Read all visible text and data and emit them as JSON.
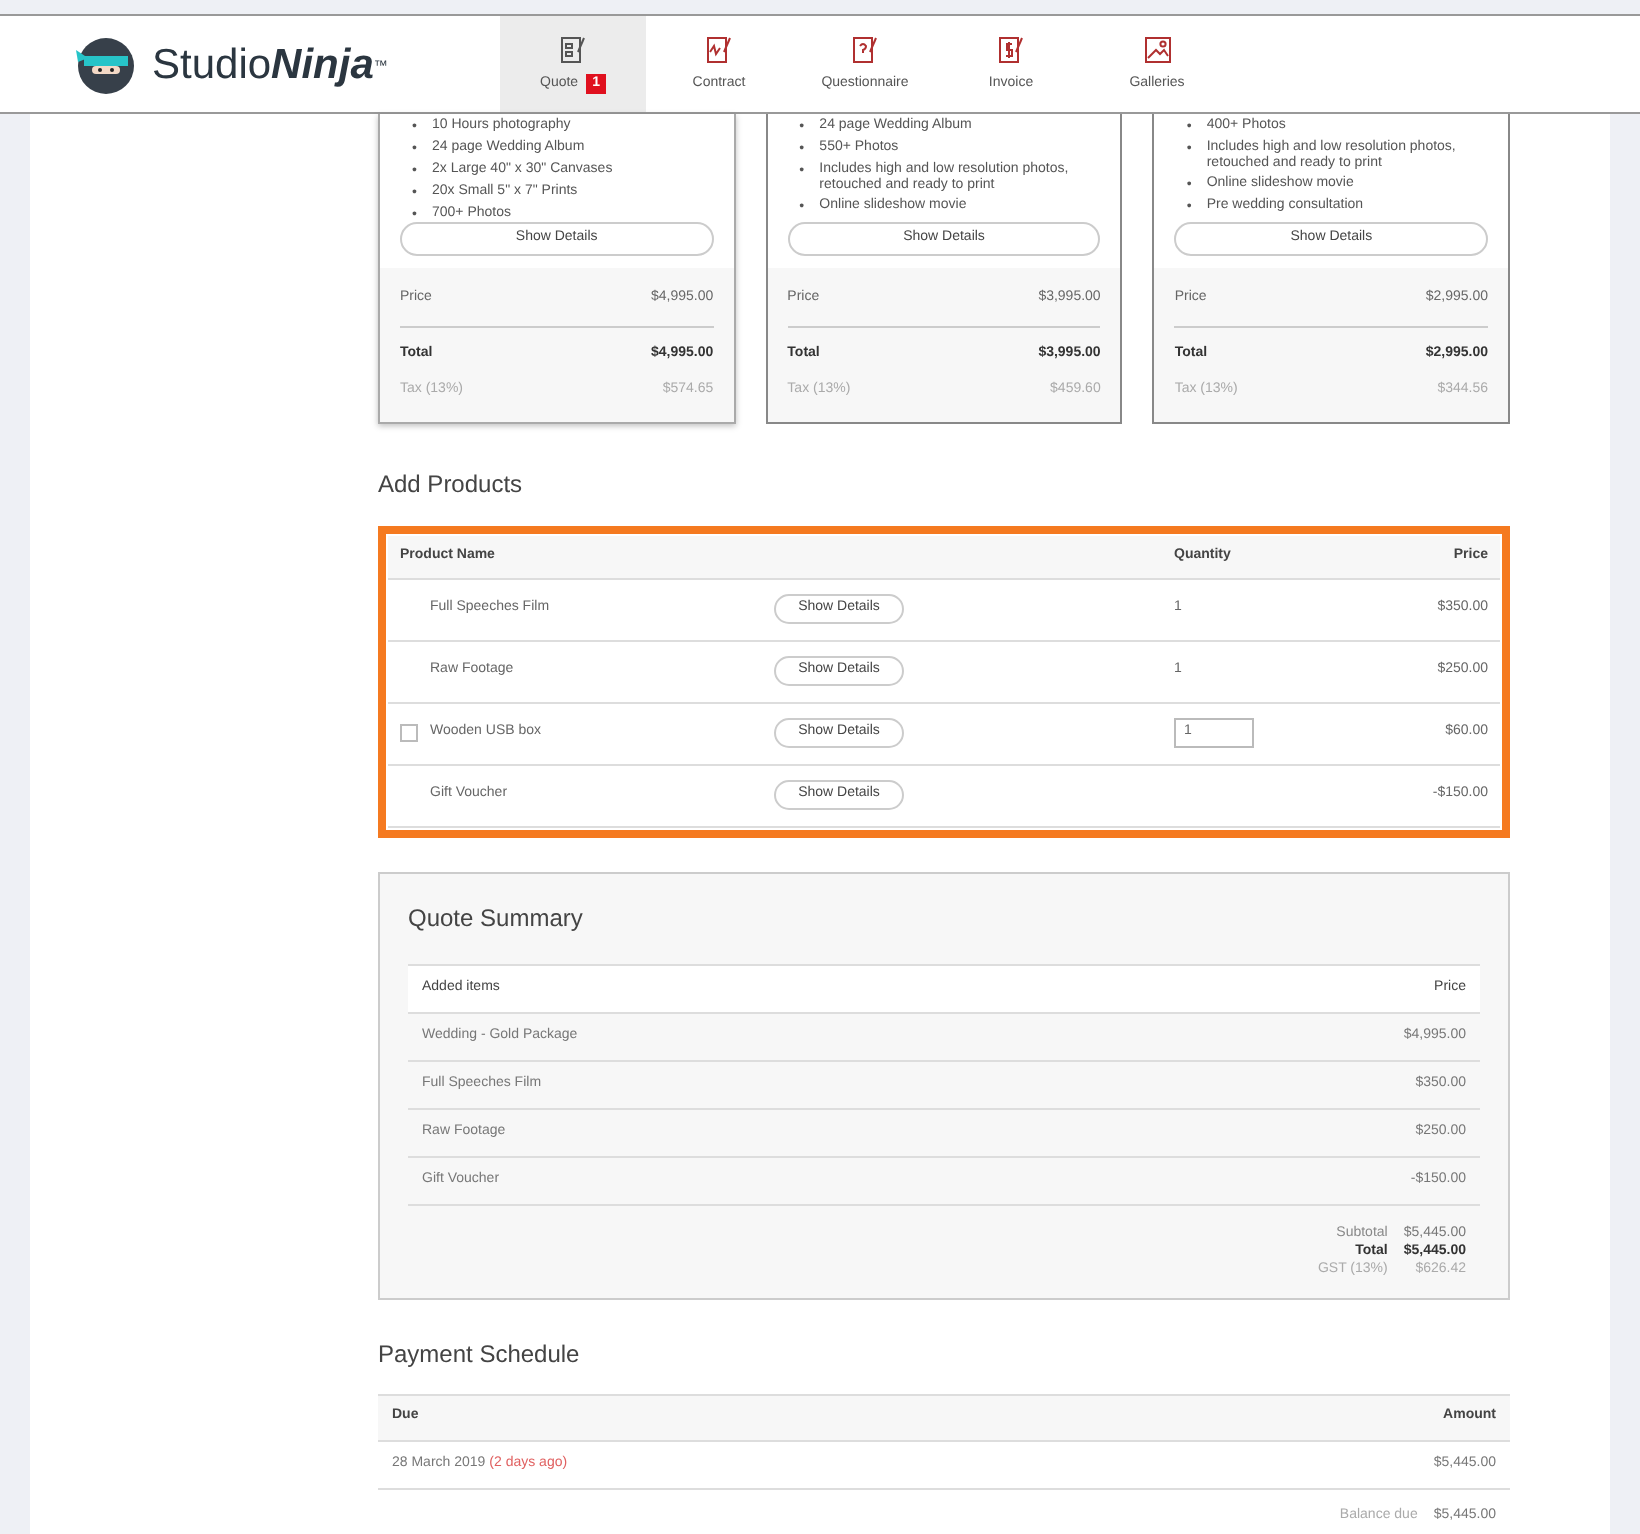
{
  "brand": {
    "name_light": "Studio",
    "name_bold": "Ninja",
    "mark": "™"
  },
  "nav": [
    {
      "label": "Quote",
      "selected": true,
      "badge": "1"
    },
    {
      "label": "Contract",
      "selected": false
    },
    {
      "label": "Questionnaire",
      "selected": false
    },
    {
      "label": "Invoice",
      "selected": false
    },
    {
      "label": "Galleries",
      "selected": false
    }
  ],
  "bullet": "•",
  "packages": [
    {
      "selected": true,
      "features": [
        "10 Hours photography",
        "24 page Wedding Album",
        "2x Large 40\" x 30\" Canvases",
        "20x Small 5\" x 7\" Prints",
        "700+ Photos"
      ],
      "button": "Show Details",
      "price_label": "Price",
      "price": "$4,995.00",
      "total_label": "Total",
      "total": "$4,995.00",
      "tax_label": "Tax (13%)",
      "tax": "$574.65"
    },
    {
      "selected": false,
      "features": [
        "24 page Wedding Album",
        "550+ Photos",
        "Includes high and low resolution photos, retouched and ready to print",
        "Online slideshow movie"
      ],
      "button": "Show Details",
      "price_label": "Price",
      "price": "$3,995.00",
      "total_label": "Total",
      "total": "$3,995.00",
      "tax_label": "Tax (13%)",
      "tax": "$459.60"
    },
    {
      "selected": false,
      "features": [
        "400+ Photos",
        "Includes high and low resolution photos, retouched and ready to print",
        "Online slideshow movie",
        "Pre wedding consultation"
      ],
      "button": "Show Details",
      "price_label": "Price",
      "price": "$2,995.00",
      "total_label": "Total",
      "total": "$2,995.00",
      "tax_label": "Tax (13%)",
      "tax": "$344.56"
    }
  ],
  "add_products": {
    "title": "Add Products",
    "columns": [
      "Product Name",
      "Quantity",
      "Price"
    ],
    "rows": [
      {
        "kind": "fixed",
        "name": "Full Speeches Film",
        "button": "Show Details",
        "quantity": "1",
        "price": "$350.00"
      },
      {
        "kind": "fixed",
        "name": "Raw Footage",
        "button": "Show Details",
        "quantity": "1",
        "price": "$250.00"
      },
      {
        "kind": "optional",
        "checked": false,
        "name": "Wooden USB box",
        "button": "Show Details",
        "quantity": "1",
        "price": "$60.00"
      },
      {
        "kind": "fixed",
        "name": "Gift Voucher",
        "button": "Show Details",
        "price": "-$150.00"
      }
    ]
  },
  "quote_summary": {
    "title": "Quote Summary",
    "columns": [
      "Added items",
      "Price"
    ],
    "rows": [
      {
        "item": "Wedding - Gold Package",
        "price": "$4,995.00"
      },
      {
        "item": "Full Speeches Film",
        "price": "$350.00"
      },
      {
        "item": "Raw Footage",
        "price": "$250.00"
      },
      {
        "item": "Gift Voucher",
        "price": "-$150.00"
      }
    ],
    "subtotal_label": "Subtotal",
    "subtotal": "$5,445.00",
    "total_label": "Total",
    "total": "$5,445.00",
    "tax_label": "GST (13%)",
    "tax": "$626.42"
  },
  "payment_schedule": {
    "title": "Payment Schedule",
    "columns": [
      "Due",
      "Amount"
    ],
    "rows": [
      {
        "date": "28 March 2019",
        "relative": "(2 days ago)",
        "amount": "$5,445.00"
      }
    ],
    "balance_label": "Balance due",
    "balance": "$5,445.00"
  }
}
